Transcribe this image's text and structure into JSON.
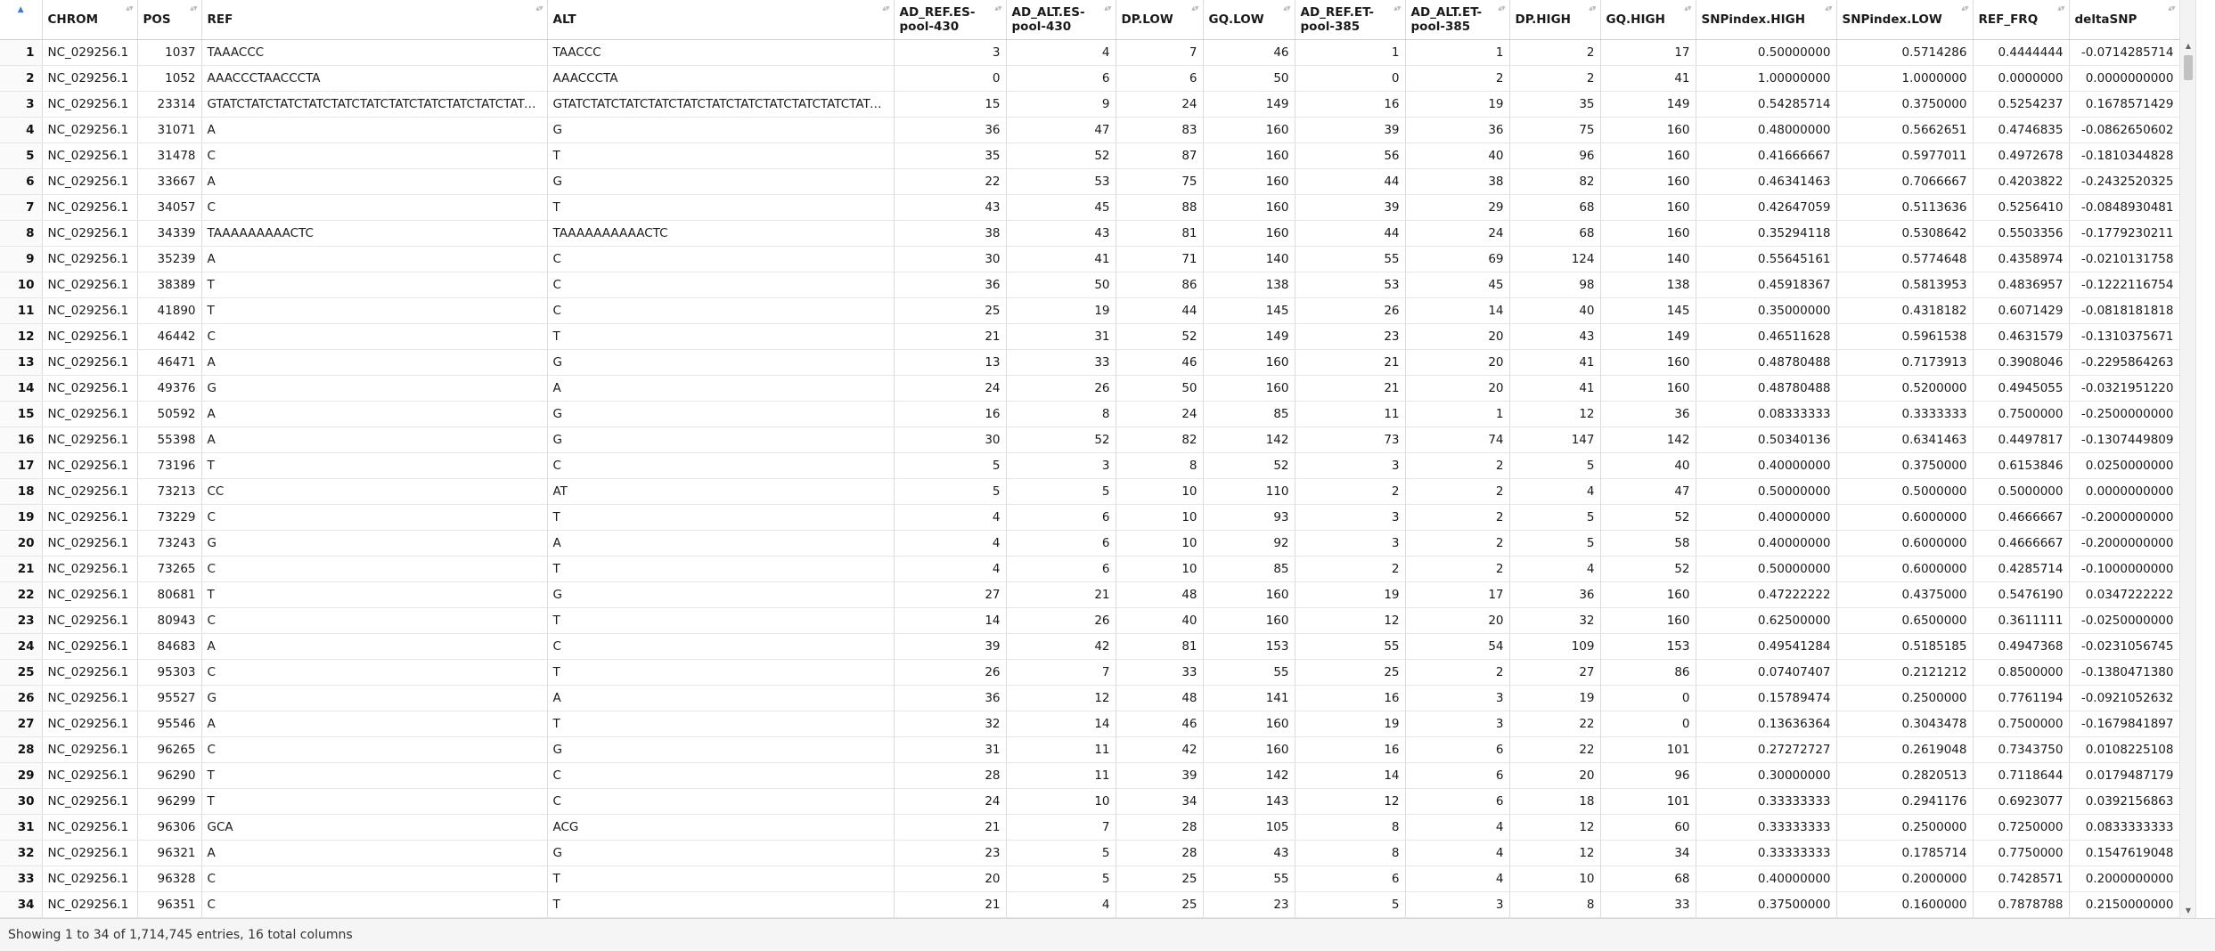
{
  "table": {
    "columns": [
      {
        "label": "",
        "align": "rn"
      },
      {
        "label": "CHROM",
        "align": "txt"
      },
      {
        "label": "POS",
        "align": "num"
      },
      {
        "label": "REF",
        "align": "txt"
      },
      {
        "label": "ALT",
        "align": "txt"
      },
      {
        "label": "AD_REF.ES-pool-430",
        "align": "num"
      },
      {
        "label": "AD_ALT.ES-pool-430",
        "align": "num"
      },
      {
        "label": "DP.LOW",
        "align": "num"
      },
      {
        "label": "GQ.LOW",
        "align": "num"
      },
      {
        "label": "AD_REF.ET-pool-385",
        "align": "num"
      },
      {
        "label": "AD_ALT.ET-pool-385",
        "align": "num"
      },
      {
        "label": "DP.HIGH",
        "align": "num"
      },
      {
        "label": "GQ.HIGH",
        "align": "num"
      },
      {
        "label": "SNPindex.HIGH",
        "align": "num"
      },
      {
        "label": "SNPindex.LOW",
        "align": "num"
      },
      {
        "label": "REF_FRQ",
        "align": "num"
      },
      {
        "label": "deltaSNP",
        "align": "num"
      }
    ],
    "rows": [
      [
        "1",
        "NC_029256.1",
        "1037",
        "TAAACCC",
        "TAACCC",
        "3",
        "4",
        "7",
        "46",
        "1",
        "1",
        "2",
        "17",
        "0.50000000",
        "0.5714286",
        "0.4444444",
        "-0.0714285714"
      ],
      [
        "2",
        "NC_029256.1",
        "1052",
        "AAACCCTAACCCTA",
        "AAACCCTA",
        "0",
        "6",
        "6",
        "50",
        "0",
        "2",
        "2",
        "41",
        "1.00000000",
        "1.0000000",
        "0.0000000",
        "0.0000000000"
      ],
      [
        "3",
        "NC_029256.1",
        "23314",
        "GTATCTATCTATCTATCTATCTATCTATCTATCTATCTATCTATCTA",
        "GTATCTATCTATCTATCTATCTATCTATCTATCTATCTATCTATCTATCTA",
        "15",
        "9",
        "24",
        "149",
        "16",
        "19",
        "35",
        "149",
        "0.54285714",
        "0.3750000",
        "0.5254237",
        "0.1678571429"
      ],
      [
        "4",
        "NC_029256.1",
        "31071",
        "A",
        "G",
        "36",
        "47",
        "83",
        "160",
        "39",
        "36",
        "75",
        "160",
        "0.48000000",
        "0.5662651",
        "0.4746835",
        "-0.0862650602"
      ],
      [
        "5",
        "NC_029256.1",
        "31478",
        "C",
        "T",
        "35",
        "52",
        "87",
        "160",
        "56",
        "40",
        "96",
        "160",
        "0.41666667",
        "0.5977011",
        "0.4972678",
        "-0.1810344828"
      ],
      [
        "6",
        "NC_029256.1",
        "33667",
        "A",
        "G",
        "22",
        "53",
        "75",
        "160",
        "44",
        "38",
        "82",
        "160",
        "0.46341463",
        "0.7066667",
        "0.4203822",
        "-0.2432520325"
      ],
      [
        "7",
        "NC_029256.1",
        "34057",
        "C",
        "T",
        "43",
        "45",
        "88",
        "160",
        "39",
        "29",
        "68",
        "160",
        "0.42647059",
        "0.5113636",
        "0.5256410",
        "-0.0848930481"
      ],
      [
        "8",
        "NC_029256.1",
        "34339",
        "TAAAAAAAAACTC",
        "TAAAAAAAAAACTC",
        "38",
        "43",
        "81",
        "160",
        "44",
        "24",
        "68",
        "160",
        "0.35294118",
        "0.5308642",
        "0.5503356",
        "-0.1779230211"
      ],
      [
        "9",
        "NC_029256.1",
        "35239",
        "A",
        "C",
        "30",
        "41",
        "71",
        "140",
        "55",
        "69",
        "124",
        "140",
        "0.55645161",
        "0.5774648",
        "0.4358974",
        "-0.0210131758"
      ],
      [
        "10",
        "NC_029256.1",
        "38389",
        "T",
        "C",
        "36",
        "50",
        "86",
        "138",
        "53",
        "45",
        "98",
        "138",
        "0.45918367",
        "0.5813953",
        "0.4836957",
        "-0.1222116754"
      ],
      [
        "11",
        "NC_029256.1",
        "41890",
        "T",
        "C",
        "25",
        "19",
        "44",
        "145",
        "26",
        "14",
        "40",
        "145",
        "0.35000000",
        "0.4318182",
        "0.6071429",
        "-0.0818181818"
      ],
      [
        "12",
        "NC_029256.1",
        "46442",
        "C",
        "T",
        "21",
        "31",
        "52",
        "149",
        "23",
        "20",
        "43",
        "149",
        "0.46511628",
        "0.5961538",
        "0.4631579",
        "-0.1310375671"
      ],
      [
        "13",
        "NC_029256.1",
        "46471",
        "A",
        "G",
        "13",
        "33",
        "46",
        "160",
        "21",
        "20",
        "41",
        "160",
        "0.48780488",
        "0.7173913",
        "0.3908046",
        "-0.2295864263"
      ],
      [
        "14",
        "NC_029256.1",
        "49376",
        "G",
        "A",
        "24",
        "26",
        "50",
        "160",
        "21",
        "20",
        "41",
        "160",
        "0.48780488",
        "0.5200000",
        "0.4945055",
        "-0.0321951220"
      ],
      [
        "15",
        "NC_029256.1",
        "50592",
        "A",
        "G",
        "16",
        "8",
        "24",
        "85",
        "11",
        "1",
        "12",
        "36",
        "0.08333333",
        "0.3333333",
        "0.7500000",
        "-0.2500000000"
      ],
      [
        "16",
        "NC_029256.1",
        "55398",
        "A",
        "G",
        "30",
        "52",
        "82",
        "142",
        "73",
        "74",
        "147",
        "142",
        "0.50340136",
        "0.6341463",
        "0.4497817",
        "-0.1307449809"
      ],
      [
        "17",
        "NC_029256.1",
        "73196",
        "T",
        "C",
        "5",
        "3",
        "8",
        "52",
        "3",
        "2",
        "5",
        "40",
        "0.40000000",
        "0.3750000",
        "0.6153846",
        "0.0250000000"
      ],
      [
        "18",
        "NC_029256.1",
        "73213",
        "CC",
        "AT",
        "5",
        "5",
        "10",
        "110",
        "2",
        "2",
        "4",
        "47",
        "0.50000000",
        "0.5000000",
        "0.5000000",
        "0.0000000000"
      ],
      [
        "19",
        "NC_029256.1",
        "73229",
        "C",
        "T",
        "4",
        "6",
        "10",
        "93",
        "3",
        "2",
        "5",
        "52",
        "0.40000000",
        "0.6000000",
        "0.4666667",
        "-0.2000000000"
      ],
      [
        "20",
        "NC_029256.1",
        "73243",
        "G",
        "A",
        "4",
        "6",
        "10",
        "92",
        "3",
        "2",
        "5",
        "58",
        "0.40000000",
        "0.6000000",
        "0.4666667",
        "-0.2000000000"
      ],
      [
        "21",
        "NC_029256.1",
        "73265",
        "C",
        "T",
        "4",
        "6",
        "10",
        "85",
        "2",
        "2",
        "4",
        "52",
        "0.50000000",
        "0.6000000",
        "0.4285714",
        "-0.1000000000"
      ],
      [
        "22",
        "NC_029256.1",
        "80681",
        "T",
        "G",
        "27",
        "21",
        "48",
        "160",
        "19",
        "17",
        "36",
        "160",
        "0.47222222",
        "0.4375000",
        "0.5476190",
        "0.0347222222"
      ],
      [
        "23",
        "NC_029256.1",
        "80943",
        "C",
        "T",
        "14",
        "26",
        "40",
        "160",
        "12",
        "20",
        "32",
        "160",
        "0.62500000",
        "0.6500000",
        "0.3611111",
        "-0.0250000000"
      ],
      [
        "24",
        "NC_029256.1",
        "84683",
        "A",
        "C",
        "39",
        "42",
        "81",
        "153",
        "55",
        "54",
        "109",
        "153",
        "0.49541284",
        "0.5185185",
        "0.4947368",
        "-0.0231056745"
      ],
      [
        "25",
        "NC_029256.1",
        "95303",
        "C",
        "T",
        "26",
        "7",
        "33",
        "55",
        "25",
        "2",
        "27",
        "86",
        "0.07407407",
        "0.2121212",
        "0.8500000",
        "-0.1380471380"
      ],
      [
        "26",
        "NC_029256.1",
        "95527",
        "G",
        "A",
        "36",
        "12",
        "48",
        "141",
        "16",
        "3",
        "19",
        "0",
        "0.15789474",
        "0.2500000",
        "0.7761194",
        "-0.0921052632"
      ],
      [
        "27",
        "NC_029256.1",
        "95546",
        "A",
        "T",
        "32",
        "14",
        "46",
        "160",
        "19",
        "3",
        "22",
        "0",
        "0.13636364",
        "0.3043478",
        "0.7500000",
        "-0.1679841897"
      ],
      [
        "28",
        "NC_029256.1",
        "96265",
        "C",
        "G",
        "31",
        "11",
        "42",
        "160",
        "16",
        "6",
        "22",
        "101",
        "0.27272727",
        "0.2619048",
        "0.7343750",
        "0.0108225108"
      ],
      [
        "29",
        "NC_029256.1",
        "96290",
        "T",
        "C",
        "28",
        "11",
        "39",
        "142",
        "14",
        "6",
        "20",
        "96",
        "0.30000000",
        "0.2820513",
        "0.7118644",
        "0.0179487179"
      ],
      [
        "30",
        "NC_029256.1",
        "96299",
        "T",
        "C",
        "24",
        "10",
        "34",
        "143",
        "12",
        "6",
        "18",
        "101",
        "0.33333333",
        "0.2941176",
        "0.6923077",
        "0.0392156863"
      ],
      [
        "31",
        "NC_029256.1",
        "96306",
        "GCA",
        "ACG",
        "21",
        "7",
        "28",
        "105",
        "8",
        "4",
        "12",
        "60",
        "0.33333333",
        "0.2500000",
        "0.7250000",
        "0.0833333333"
      ],
      [
        "32",
        "NC_029256.1",
        "96321",
        "A",
        "G",
        "23",
        "5",
        "28",
        "43",
        "8",
        "4",
        "12",
        "34",
        "0.33333333",
        "0.1785714",
        "0.7750000",
        "0.1547619048"
      ],
      [
        "33",
        "NC_029256.1",
        "96328",
        "C",
        "T",
        "20",
        "5",
        "25",
        "55",
        "6",
        "4",
        "10",
        "68",
        "0.40000000",
        "0.2000000",
        "0.7428571",
        "0.2000000000"
      ],
      [
        "34",
        "NC_029256.1",
        "96351",
        "C",
        "T",
        "21",
        "4",
        "25",
        "23",
        "5",
        "3",
        "8",
        "33",
        "0.37500000",
        "0.1600000",
        "0.7878788",
        "0.2150000000"
      ]
    ]
  },
  "icons": {
    "sort_ascending": "▲",
    "sort_both": "▲▼",
    "scroll_up": "▲",
    "scroll_down": "▼"
  },
  "footer": {
    "status": "Showing 1 to 34 of 1,714,745 entries, 16 total columns"
  }
}
